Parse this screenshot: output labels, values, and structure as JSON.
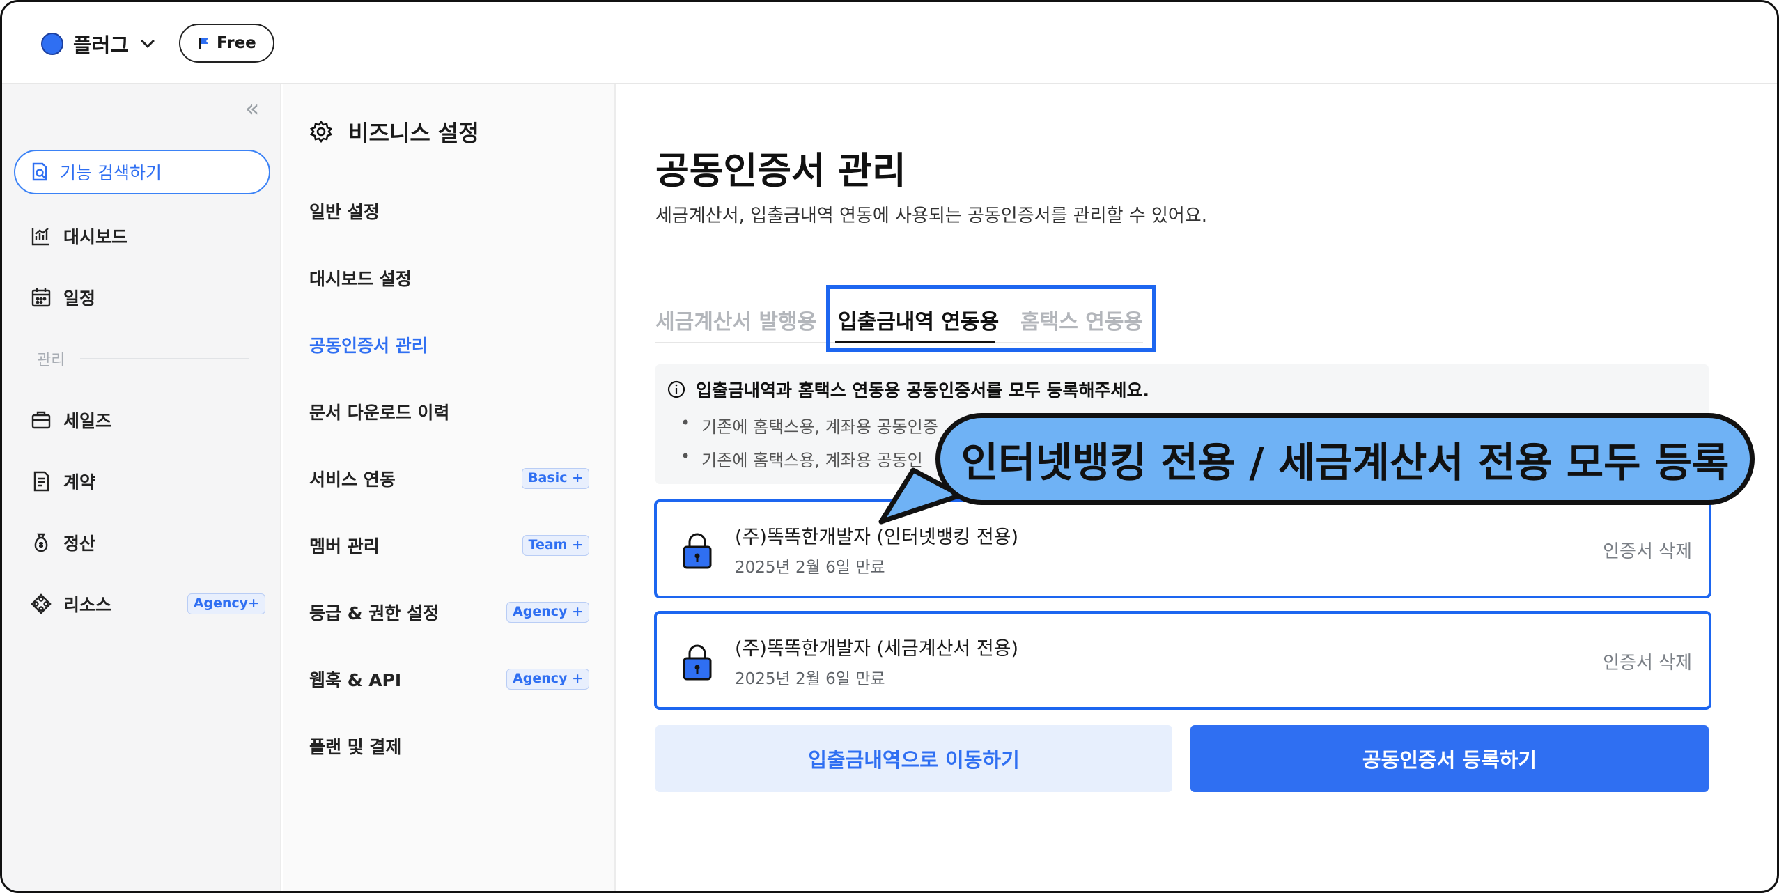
{
  "workspace": {
    "name": "플러그",
    "plan": "Free"
  },
  "sidebar": {
    "search_placeholder": "기능 검색하기",
    "items": [
      {
        "label": "대시보드",
        "icon": "chart-icon"
      },
      {
        "label": "일정",
        "icon": "calendar-icon"
      }
    ],
    "section_label": "관리",
    "manage_items": [
      {
        "label": "세일즈",
        "icon": "briefcase-icon"
      },
      {
        "label": "계약",
        "icon": "document-icon"
      },
      {
        "label": "정산",
        "icon": "money-bag-icon"
      },
      {
        "label": "리소스",
        "icon": "resource-icon",
        "badge": "Agency+"
      }
    ]
  },
  "settings": {
    "title": "비즈니스 설정",
    "items": [
      {
        "label": "일반 설정"
      },
      {
        "label": "대시보드 설정"
      },
      {
        "label": "공동인증서 관리",
        "active": true
      },
      {
        "label": "문서 다운로드 이력"
      },
      {
        "label": "서비스 연동",
        "badge": "Basic +"
      },
      {
        "label": "멤버 관리",
        "badge": "Team +"
      },
      {
        "label": "등급 & 권한 설정",
        "badge": "Agency +"
      },
      {
        "label": "웹훅 & API",
        "badge": "Agency +"
      },
      {
        "label": "플랜 및 결제"
      }
    ]
  },
  "main": {
    "title": "공동인증서 관리",
    "description": "세금계산서, 입출금내역 연동에 사용되는 공동인증서를 관리할 수 있어요.",
    "tabs": [
      {
        "label": "세금계산서 발행용"
      },
      {
        "label": "입출금내역 연동용",
        "active": true
      },
      {
        "label": "홈택스 연동용"
      }
    ],
    "notice": {
      "heading": "입출금내역과 홈택스 연동용 공동인증서를 모두 등록해주세요.",
      "bullets": [
        "기존에 홈택스용, 계좌용 공동인증",
        "기존에 홈택스용, 계좌용 공동인"
      ]
    },
    "certificates": [
      {
        "name": "(주)똑똑한개발자 (인터넷뱅킹 전용)",
        "expiry": "2025년 2월 6일 만료",
        "delete_label": "인증서 삭제"
      },
      {
        "name": "(주)똑똑한개발자 (세금계산서 전용)",
        "expiry": "2025년 2월 6일 만료",
        "delete_label": "인증서 삭제"
      }
    ],
    "buttons": {
      "secondary": "입출금내역으로 이동하기",
      "primary": "공동인증서 등록하기"
    }
  },
  "callout": {
    "text": "인터넷뱅킹 전용 / 세금계산서 전용 모두 등록"
  },
  "colors": {
    "accent": "#2f6ff2",
    "highlight_border": "#1d66f0",
    "callout_fill": "#6fb2f5"
  }
}
